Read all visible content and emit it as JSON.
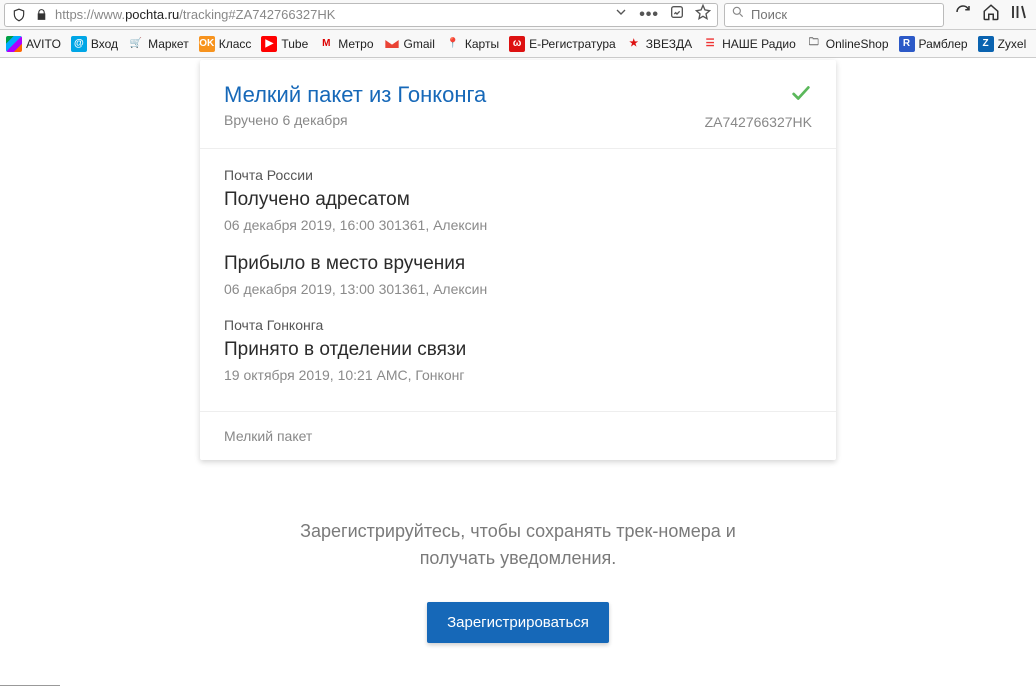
{
  "url": {
    "pre": "https://www.",
    "host": "pochta.ru",
    "path": "/tracking#ZA742766327HK"
  },
  "search": {
    "placeholder": "Поиск"
  },
  "bookmarks": [
    {
      "label": "AVITO"
    },
    {
      "label": "Вход"
    },
    {
      "label": "Маркет"
    },
    {
      "label": "Класс"
    },
    {
      "label": "Tube"
    },
    {
      "label": "Метро"
    },
    {
      "label": "Gmail"
    },
    {
      "label": "Карты"
    },
    {
      "label": "Е-Регистратура"
    },
    {
      "label": "ЗВЕЗДА"
    },
    {
      "label": "НАШЕ Радио"
    },
    {
      "label": "OnlineShop"
    },
    {
      "label": "Рамблер"
    },
    {
      "label": "Zyxel"
    }
  ],
  "card": {
    "title": "Мелкий пакет из Гонконга",
    "subtitle": "Вручено 6 декабря",
    "tracking_number": "ZA742766327HK",
    "footer": "Мелкий пакет",
    "group1_label": "Почта России",
    "event1": {
      "title": "Получено адресатом",
      "meta": "06 декабря 2019, 16:00 301361, Алексин"
    },
    "event2": {
      "title": "Прибыло в место вручения",
      "meta": "06 декабря 2019, 13:00 301361, Алексин"
    },
    "group2_label": "Почта Гонконга",
    "event3": {
      "title": "Принято в отделении связи",
      "meta": "19 октября 2019, 10:21 AMC, Гонконг"
    }
  },
  "promo": {
    "line1": "Зарегистрируйтесь, чтобы сохранять трек-номера и",
    "line2": "получать уведомления.",
    "button": "Зарегистрироваться"
  }
}
